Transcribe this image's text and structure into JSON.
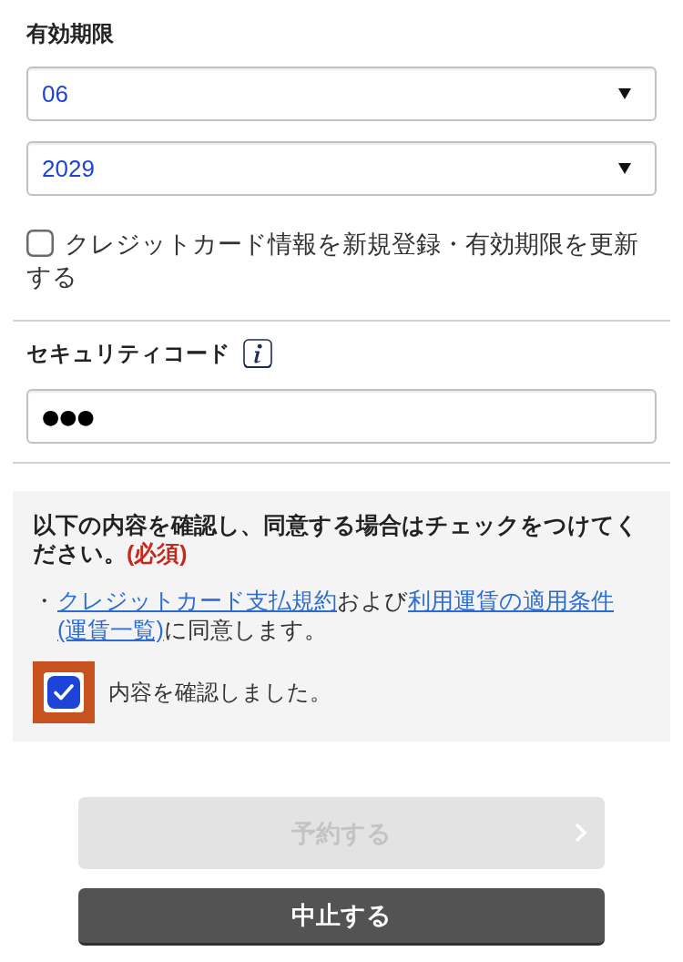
{
  "expiry": {
    "label": "有効期限",
    "selects": [
      {
        "value": "06"
      },
      {
        "value": "2029"
      }
    ]
  },
  "register_option": {
    "label": "クレジットカード情報を新規登録・有効期限を更新する",
    "checked": false
  },
  "security_code": {
    "label": "セキュリティコード",
    "value": "●●●"
  },
  "agreement": {
    "heading": "以下の内容を確認し、同意する場合はチェックをつけてください。",
    "required": "(必須)",
    "bullet": "・",
    "terms": [
      {
        "kind": "link",
        "text": "クレジットカード支払規約"
      },
      {
        "kind": "text",
        "text": "および"
      },
      {
        "kind": "link",
        "text": "利用運賃の適用条件"
      },
      {
        "kind": "link",
        "text": "(運賃一覧)"
      },
      {
        "kind": "text",
        "text": "に同意します。"
      }
    ],
    "confirm": {
      "label": "内容を確認しました。",
      "checked": true,
      "highlighted": true
    }
  },
  "buttons": [
    {
      "kind": "primary",
      "label": "予約する",
      "disabled": true
    },
    {
      "kind": "secondary",
      "label": "中止する",
      "disabled": false
    }
  ]
}
